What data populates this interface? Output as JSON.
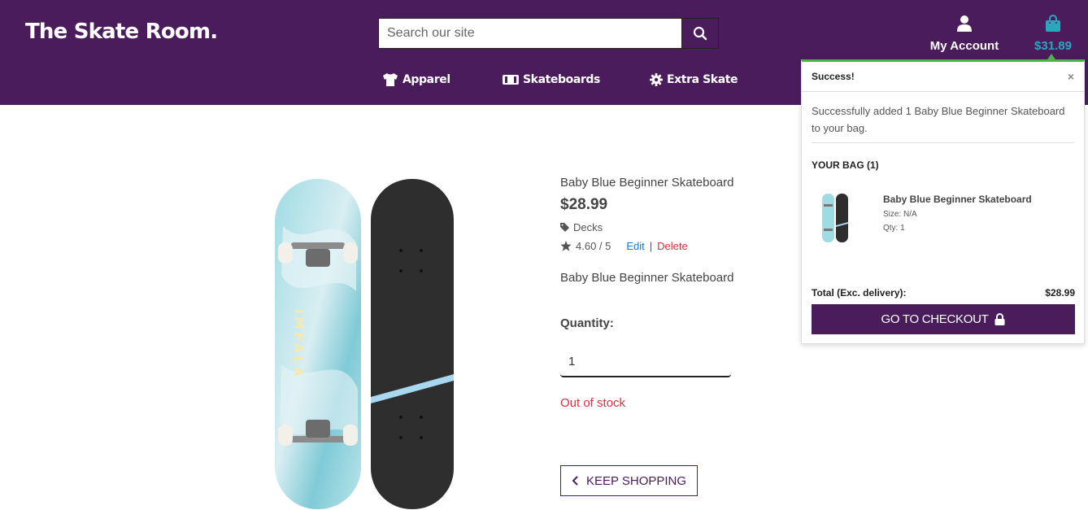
{
  "header": {
    "brand": "The Skate Room.",
    "search_placeholder": "Search our site",
    "account_label": "My Account",
    "bag_total": "$31.89"
  },
  "nav": {
    "items": [
      {
        "label": "Apparel",
        "icon": "tshirt-icon"
      },
      {
        "label": "Skateboards",
        "icon": "skateboard-icon"
      },
      {
        "label": "Extra Skate",
        "icon": "gear-icon"
      }
    ]
  },
  "product": {
    "name": "Baby Blue Beginner Skateboard",
    "price": "$28.99",
    "category": "Decks",
    "rating": "4.60 / 5",
    "edit_label": "Edit",
    "separator": "|",
    "delete_label": "Delete",
    "description": "Baby Blue Beginner Skateboard",
    "quantity_label": "Quantity:",
    "quantity_value": "1",
    "stock_status": "Out of stock",
    "keep_shopping_label": "KEEP SHOPPING",
    "deck_brand": "IMPALA",
    "colors": {
      "deck_blue": "#8fd3dc",
      "grip": "#2e2e2e",
      "accent": "#a8d8f0"
    }
  },
  "toast": {
    "title": "Success!",
    "close_glyph": "×",
    "message": "Successfully added 1 Baby Blue Beginner Skateboard to your bag.",
    "bag_title": "YOUR BAG (1)",
    "item_name": "Baby Blue Beginner Skateboard",
    "item_size": "Size: N/A",
    "item_qty": "Qty: 1",
    "total_label": "Total (Exc. delivery):",
    "total_value": "$28.99",
    "checkout_label": "GO TO CHECKOUT"
  },
  "colors": {
    "brand_purple": "#4a1c5c",
    "bag_teal": "#2aa7bd",
    "success_green": "#4bb543",
    "error_red": "#d9303f",
    "link_blue": "#1a7acb"
  }
}
